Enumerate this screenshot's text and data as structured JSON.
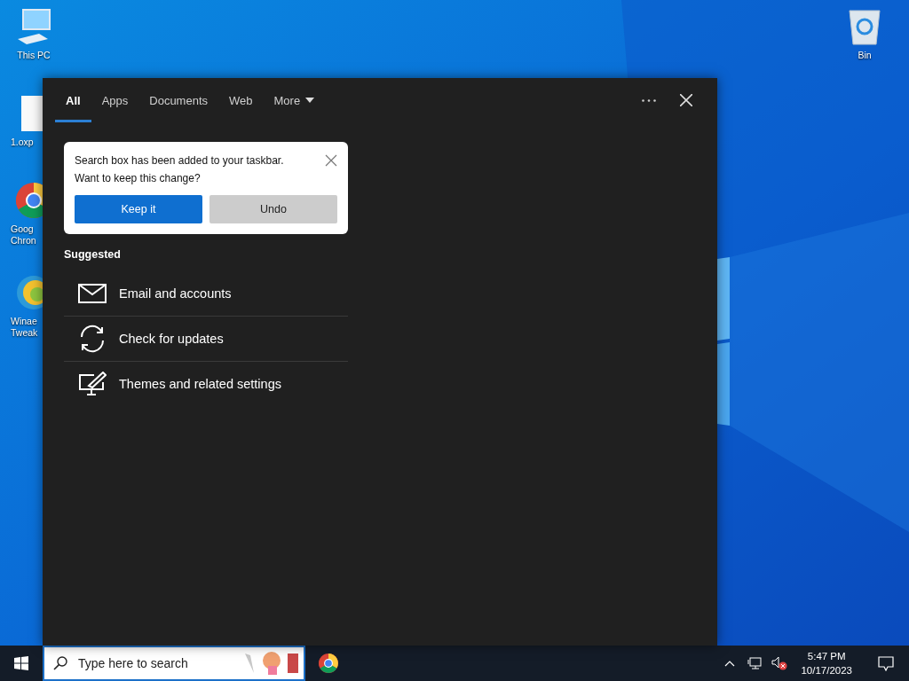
{
  "desktop_icons": [
    {
      "kind": "computer",
      "lines": [
        "This PC"
      ]
    },
    {
      "kind": "file",
      "lines": [
        "1.oxp"
      ]
    },
    {
      "kind": "chrome",
      "lines": [
        "Goog",
        "Chron"
      ]
    },
    {
      "kind": "winaero",
      "lines": [
        "Winae",
        "Tweak"
      ]
    },
    {
      "kind": "bin",
      "lines": [
        "Bin"
      ]
    }
  ],
  "search_panel": {
    "tabs": [
      {
        "label": "All",
        "selected": true,
        "kind": "tab"
      },
      {
        "label": "Apps",
        "selected": false,
        "kind": "tab"
      },
      {
        "label": "Documents",
        "selected": false,
        "kind": "tab"
      },
      {
        "label": "Web",
        "selected": false,
        "kind": "tab"
      },
      {
        "label": "More",
        "selected": false,
        "kind": "dropdown"
      }
    ],
    "notice": {
      "message_lines": [
        "Search box has been added to your taskbar.",
        "Want to keep this change?"
      ],
      "buttons": [
        {
          "label": "Keep it",
          "kind": "primary"
        },
        {
          "label": "Undo",
          "kind": "secondary"
        }
      ]
    },
    "suggested": {
      "heading": "Suggested",
      "items": [
        {
          "label": "Email and accounts",
          "kind": "mail"
        },
        {
          "label": "Check for updates",
          "kind": "sync"
        },
        {
          "label": "Themes and related settings",
          "kind": "theme"
        }
      ]
    }
  },
  "taskbar": {
    "search": {
      "placeholder": "Type here to search"
    },
    "clock": {
      "time": "5:47 PM",
      "date": "10/17/2023"
    }
  }
}
